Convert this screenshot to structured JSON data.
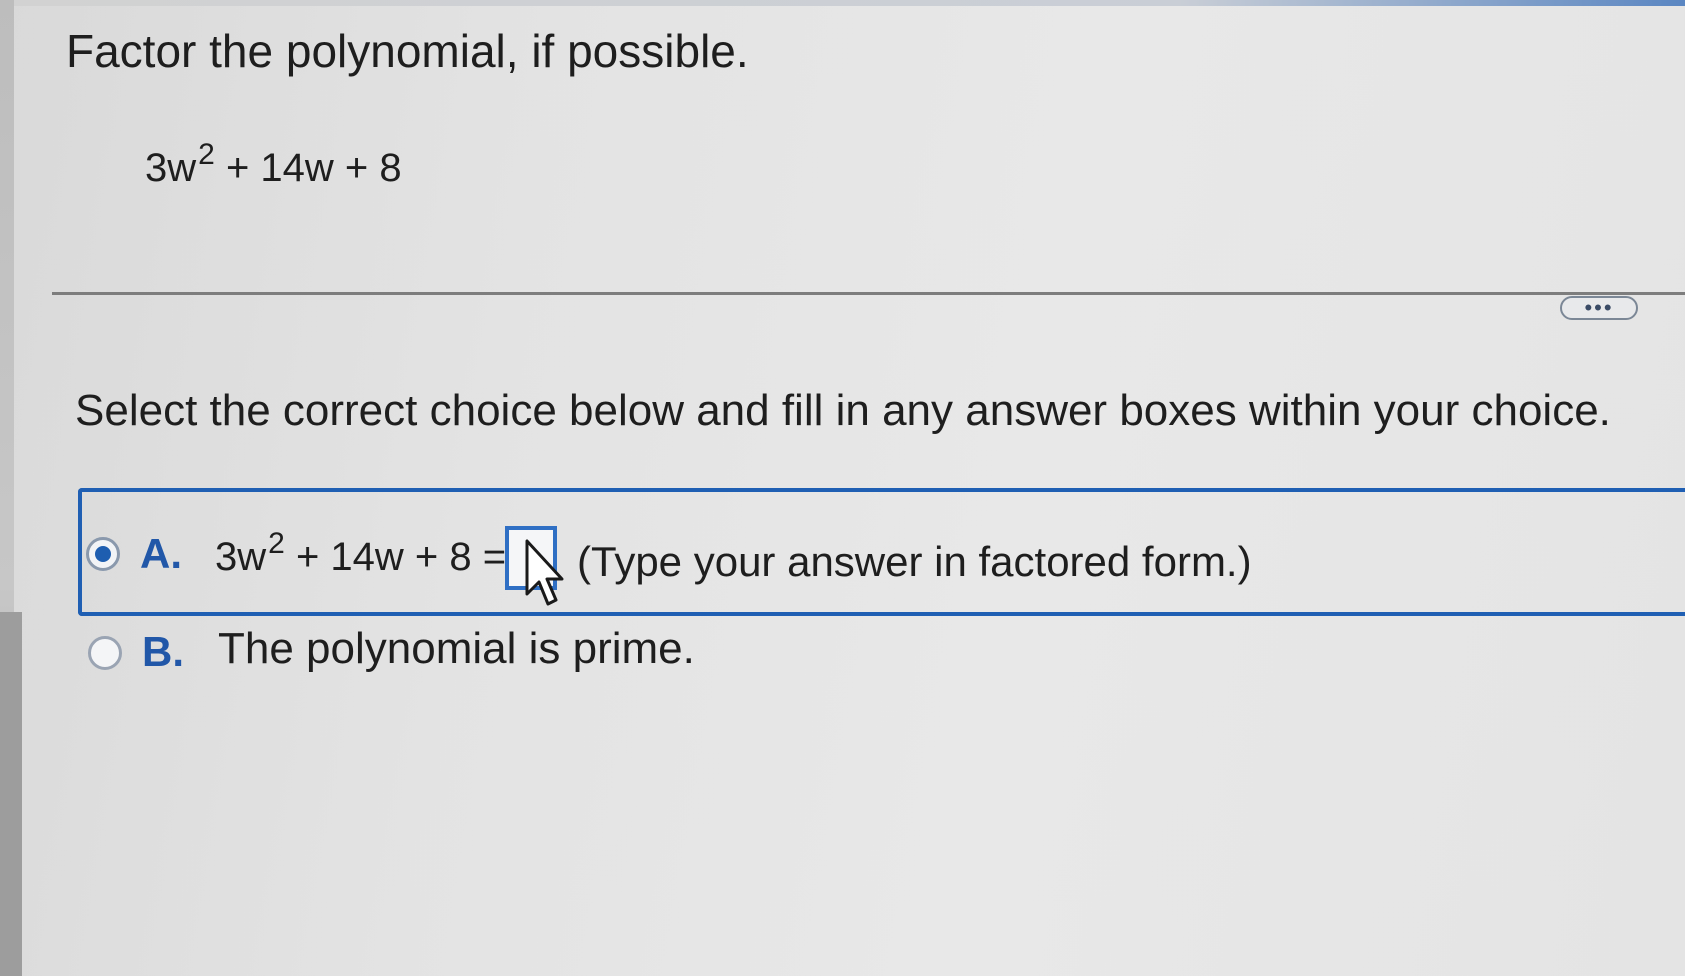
{
  "question": {
    "title": "Factor the polynomial, if possible.",
    "polynomial": {
      "base": "3w",
      "exponent": "2",
      "rest": " + 14w + 8"
    }
  },
  "more_button": {
    "label": "•••"
  },
  "instruction": "Select the correct choice below and fill in any answer boxes within your choice.",
  "choices": [
    {
      "letter": "A.",
      "equation_base": "3w",
      "equation_exponent": "2",
      "equation_rest": " + 14w + 8 =",
      "answer_value": "",
      "hint": "(Type your answer in factored form.)",
      "selected": true
    },
    {
      "letter": "B.",
      "text": "The polynomial is prime.",
      "selected": false
    }
  ],
  "colors": {
    "accent": "#1f5fb3",
    "choice_letter": "#2157a8",
    "text": "#1e1e1e"
  },
  "icons": {
    "more": "ellipsis-icon",
    "pointer": "mouse-cursor-icon"
  }
}
